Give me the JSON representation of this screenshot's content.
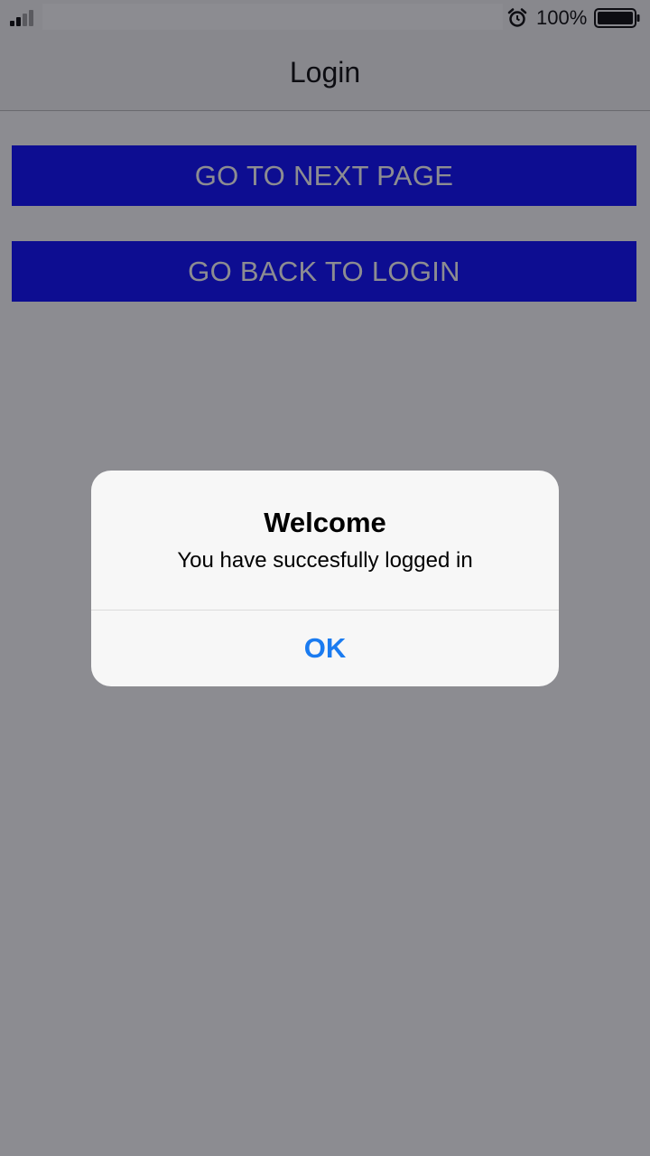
{
  "status_bar": {
    "battery_percent": "100%",
    "icons": [
      "signal-icon",
      "alarm-icon",
      "battery-icon"
    ]
  },
  "nav": {
    "title": "Login"
  },
  "buttons": {
    "next_label": "GO TO NEXT PAGE",
    "back_label": "GO BACK TO LOGIN"
  },
  "alert": {
    "title": "Welcome",
    "message": "You have succesfully logged in",
    "ok_label": "OK"
  },
  "colors": {
    "button_background": "#0000ff",
    "button_text": "#ffffff",
    "alert_action": "#1a7bf0",
    "overlay": "rgba(25,25,35,0.5)"
  }
}
